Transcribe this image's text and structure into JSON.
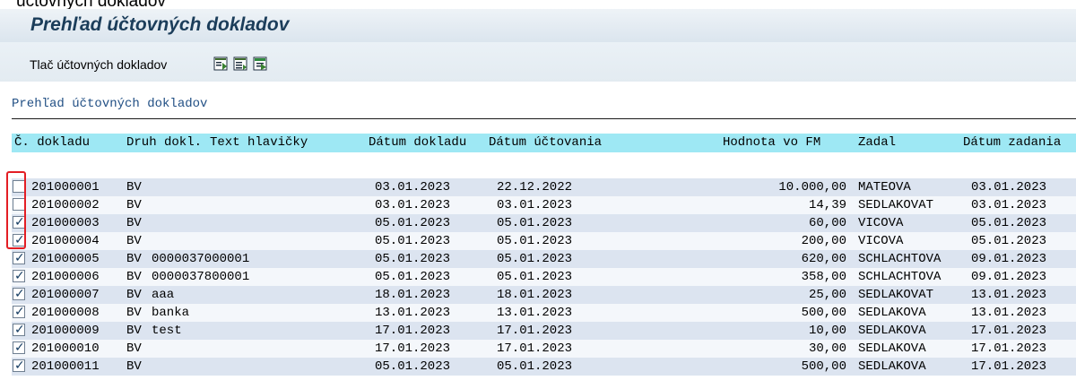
{
  "window": {
    "top_cut_text": "účtovných dokladov",
    "title": "Prehľad účtovných dokladov"
  },
  "toolbar": {
    "print_button_label": "Tlač účtovných dokladov",
    "icons": [
      "document-plus-icon",
      "document-list-icon",
      "document-export-icon"
    ]
  },
  "list": {
    "title": "Prehľad účtovných dokladov",
    "headers": {
      "doc_no": "Č. dokladu",
      "doc_type": "Druh dokl.",
      "header_text": "Text hlavičky",
      "doc_date": "Dátum dokladu",
      "posting_date": "Dátum účtovania",
      "amount": "Hodnota vo FM",
      "entered_by": "Zadal",
      "entry_date": "Dátum zadania"
    },
    "rows": [
      {
        "checked": false,
        "doc_no": "201000001",
        "doc_type": "BV",
        "header_text": "",
        "doc_date": "03.01.2023",
        "posting_date": "22.12.2022",
        "amount": "10.000,00",
        "entered_by": "MATEOVA",
        "entry_date": "03.01.2023"
      },
      {
        "checked": false,
        "doc_no": "201000002",
        "doc_type": "BV",
        "header_text": "",
        "doc_date": "03.01.2023",
        "posting_date": "03.01.2023",
        "amount": "14,39",
        "entered_by": "SEDLAKOVAT",
        "entry_date": "03.01.2023"
      },
      {
        "checked": true,
        "doc_no": "201000003",
        "doc_type": "BV",
        "header_text": "",
        "doc_date": "05.01.2023",
        "posting_date": "05.01.2023",
        "amount": "60,00",
        "entered_by": "VICOVA",
        "entry_date": "05.01.2023"
      },
      {
        "checked": true,
        "doc_no": "201000004",
        "doc_type": "BV",
        "header_text": "",
        "doc_date": "05.01.2023",
        "posting_date": "05.01.2023",
        "amount": "200,00",
        "entered_by": "VICOVA",
        "entry_date": "05.01.2023"
      },
      {
        "checked": true,
        "doc_no": "201000005",
        "doc_type": "BV",
        "header_text": "0000037000001",
        "doc_date": "05.01.2023",
        "posting_date": "05.01.2023",
        "amount": "620,00",
        "entered_by": "SCHLACHTOVA",
        "entry_date": "09.01.2023"
      },
      {
        "checked": true,
        "doc_no": "201000006",
        "doc_type": "BV",
        "header_text": "0000037800001",
        "doc_date": "05.01.2023",
        "posting_date": "05.01.2023",
        "amount": "358,00",
        "entered_by": "SCHLACHTOVA",
        "entry_date": "09.01.2023"
      },
      {
        "checked": true,
        "doc_no": "201000007",
        "doc_type": "BV",
        "header_text": "aaa",
        "doc_date": "18.01.2023",
        "posting_date": "18.01.2023",
        "amount": "25,00",
        "entered_by": "SEDLAKOVAT",
        "entry_date": "13.01.2023"
      },
      {
        "checked": true,
        "doc_no": "201000008",
        "doc_type": "BV",
        "header_text": "banka",
        "doc_date": "13.01.2023",
        "posting_date": "13.01.2023",
        "amount": "500,00",
        "entered_by": "SEDLAKOVA",
        "entry_date": "13.01.2023"
      },
      {
        "checked": true,
        "doc_no": "201000009",
        "doc_type": "BV",
        "header_text": "test",
        "doc_date": "17.01.2023",
        "posting_date": "17.01.2023",
        "amount": "10,00",
        "entered_by": "SEDLAKOVA",
        "entry_date": "17.01.2023"
      },
      {
        "checked": true,
        "doc_no": "201000010",
        "doc_type": "BV",
        "header_text": "",
        "doc_date": "17.01.2023",
        "posting_date": "17.01.2023",
        "amount": "30,00",
        "entered_by": "SEDLAKOVA",
        "entry_date": "17.01.2023"
      },
      {
        "checked": true,
        "doc_no": "201000011",
        "doc_type": "BV",
        "header_text": "",
        "doc_date": "05.01.2023",
        "posting_date": "05.01.2023",
        "amount": "500,00",
        "entered_by": "SEDLAKOVA",
        "entry_date": "17.01.2023"
      }
    ]
  },
  "colors": {
    "header_background": "#9ee8f4",
    "even_row": "#dce4f0",
    "odd_row": "#f4f7fb",
    "highlight": "#e31e24",
    "title_text": "#1b3d5a",
    "list_title": "#214f84"
  }
}
